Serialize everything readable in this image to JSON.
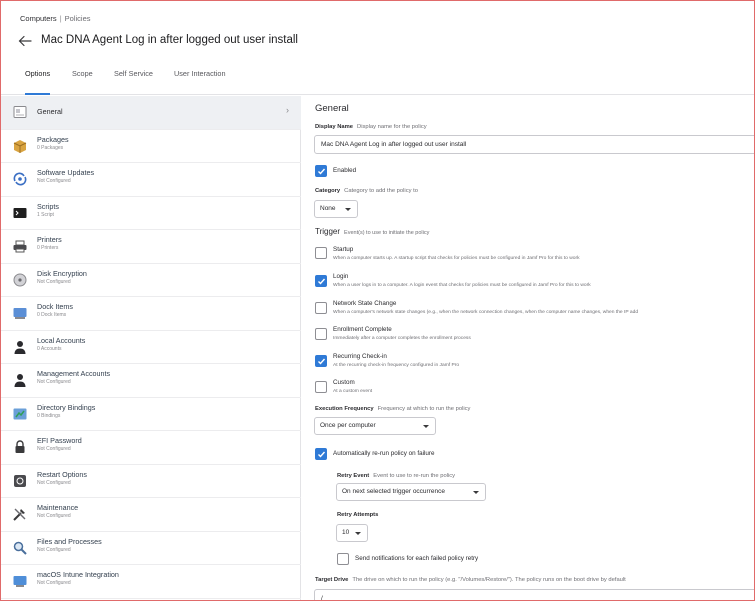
{
  "breadcrumb": {
    "root": "Computers",
    "separator": "|",
    "current": "Policies"
  },
  "page": {
    "title": "Mac DNA Agent Log in after logged out user install"
  },
  "tabs": [
    {
      "label": "Options",
      "active": true
    },
    {
      "label": "Scope"
    },
    {
      "label": "Self Service"
    },
    {
      "label": "User Interaction"
    }
  ],
  "sidebar": {
    "items": [
      {
        "label": "General",
        "sub": "",
        "icon": "general-icon",
        "selected": true
      },
      {
        "label": "Packages",
        "sub": "0 Packages",
        "icon": "packages-icon"
      },
      {
        "label": "Software Updates",
        "sub": "Not Configured",
        "icon": "software-updates-icon"
      },
      {
        "label": "Scripts",
        "sub": "1 Script",
        "icon": "scripts-icon"
      },
      {
        "label": "Printers",
        "sub": "0 Printers",
        "icon": "printers-icon"
      },
      {
        "label": "Disk Encryption",
        "sub": "Not Configured",
        "icon": "disk-encryption-icon"
      },
      {
        "label": "Dock Items",
        "sub": "0 Dock Items",
        "icon": "dock-items-icon"
      },
      {
        "label": "Local Accounts",
        "sub": "0 Accounts",
        "icon": "local-accounts-icon"
      },
      {
        "label": "Management Accounts",
        "sub": "Not Configured",
        "icon": "management-accounts-icon"
      },
      {
        "label": "Directory Bindings",
        "sub": "0 Bindings",
        "icon": "directory-bindings-icon"
      },
      {
        "label": "EFI Password",
        "sub": "Not Configured",
        "icon": "efi-password-icon"
      },
      {
        "label": "Restart Options",
        "sub": "Not Configured",
        "icon": "restart-options-icon"
      },
      {
        "label": "Maintenance",
        "sub": "Not Configured",
        "icon": "maintenance-icon"
      },
      {
        "label": "Files and Processes",
        "sub": "Not Configured",
        "icon": "files-processes-icon"
      },
      {
        "label": "macOS Intune Integration",
        "sub": "Not Configured",
        "icon": "intune-icon"
      }
    ],
    "chevron": "›"
  },
  "general": {
    "title": "General",
    "display_name": {
      "label": "Display Name",
      "hint": "Display name for the policy",
      "value": "Mac DNA Agent Log in after logged out user install"
    },
    "enabled": {
      "label": "Enabled",
      "checked": true
    },
    "category": {
      "label": "Category",
      "hint": "Category to add the policy to",
      "value": "None"
    },
    "trigger": {
      "label": "Trigger",
      "hint": "Event(s) to use to initiate the policy",
      "options": [
        {
          "label": "Startup",
          "desc": "When a computer starts up. A startup script that checks for policies must be configured in Jamf Pro for this to work",
          "checked": false
        },
        {
          "label": "Login",
          "desc": "When a user logs in to a computer. A login event that checks for policies must be configured in Jamf Pro for this to work",
          "checked": true
        },
        {
          "label": "Network State Change",
          "desc": "When a computer's network state changes (e.g., when the network connection changes, when the computer name changes, when the IP add",
          "checked": false
        },
        {
          "label": "Enrollment Complete",
          "desc": "Immediately after a computer completes the enrollment process",
          "checked": false
        },
        {
          "label": "Recurring Check-in",
          "desc": "At the recurring check-in frequency configured in Jamf Pro",
          "checked": true
        },
        {
          "label": "Custom",
          "desc": "At a custom event",
          "checked": false
        }
      ]
    },
    "execution_frequency": {
      "label": "Execution Frequency",
      "hint": "Frequency at which to run the policy",
      "value": "Once per computer"
    },
    "auto_rerun": {
      "label": "Automatically re-run policy on failure",
      "checked": true
    },
    "retry_event": {
      "label": "Retry Event",
      "hint": "Event to use to re-run the policy",
      "value": "On next selected trigger occurrence"
    },
    "retry_attempts": {
      "label": "Retry Attempts",
      "value": "10"
    },
    "notify_failed": {
      "label": "Send notifications for each failed policy retry",
      "checked": false
    },
    "target_drive": {
      "label": "Target Drive",
      "hint": "The drive on which to run the policy (e.g. \"/Volumes/Restore/\"). The policy runs on the boot drive by default",
      "value": "/"
    }
  },
  "colors": {
    "accent": "#2f7ad6",
    "frame_border": "#e06a6a",
    "selected_row": "#eef0f3"
  }
}
